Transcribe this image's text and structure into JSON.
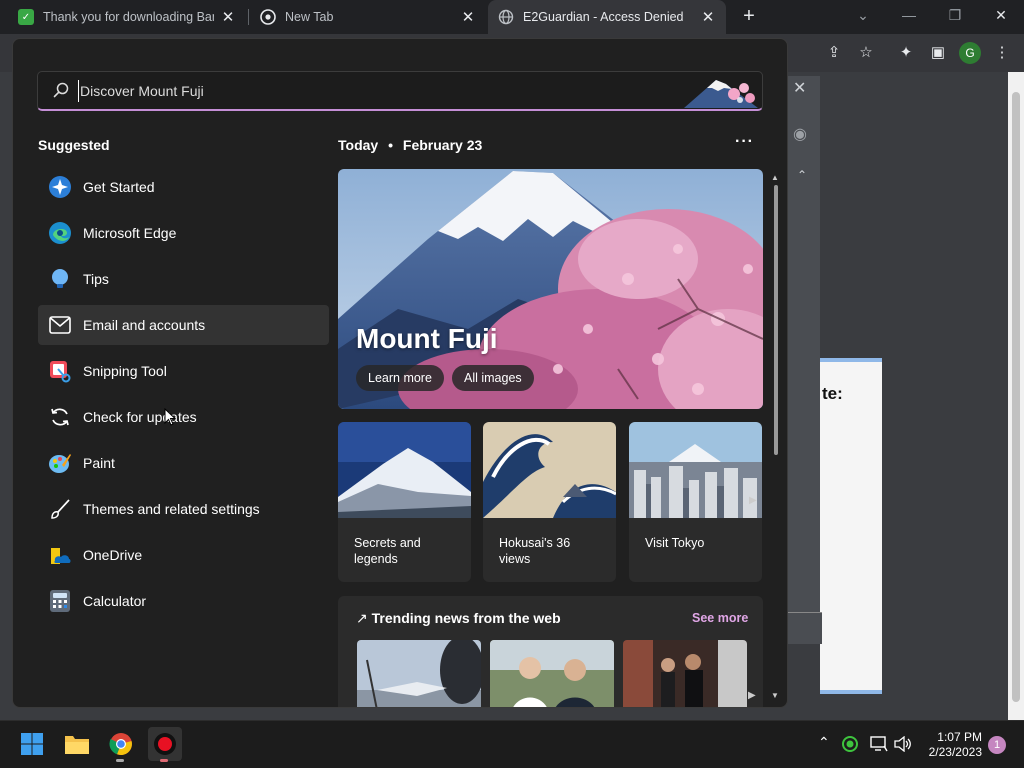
{
  "browser": {
    "tabs": [
      {
        "title": "Thank you for downloading Band",
        "close": "✕"
      },
      {
        "title": "New Tab",
        "close": "✕"
      },
      {
        "title": "E2Guardian - Access Denied",
        "close": "✕"
      }
    ],
    "new_tab": "+",
    "profile_initial": "G"
  },
  "page": {
    "partial_text": "te:"
  },
  "search": {
    "placeholder": "Discover Mount Fuji",
    "value": "Discover Mount Fuji"
  },
  "suggested": {
    "title": "Suggested",
    "apps": [
      {
        "label": "Get Started",
        "icon": "get-started-icon"
      },
      {
        "label": "Microsoft Edge",
        "icon": "edge-icon"
      },
      {
        "label": "Tips",
        "icon": "tips-icon"
      },
      {
        "label": "Email and accounts",
        "icon": "mail-icon"
      },
      {
        "label": "Snipping Tool",
        "icon": "snipping-tool-icon"
      },
      {
        "label": "Check for updates",
        "icon": "refresh-icon"
      },
      {
        "label": "Paint",
        "icon": "paint-icon"
      },
      {
        "label": "Themes and related settings",
        "icon": "brush-icon"
      },
      {
        "label": "OneDrive",
        "icon": "onedrive-icon"
      },
      {
        "label": "Calculator",
        "icon": "calculator-icon"
      }
    ]
  },
  "feed": {
    "today": "Today",
    "date": "February 23",
    "more": "···",
    "hero": {
      "title": "Mount Fuji",
      "learn_more": "Learn more",
      "all_images": "All images"
    },
    "cards": [
      {
        "label": "Secrets and legends"
      },
      {
        "label": "Hokusai's 36 views"
      },
      {
        "label": "Visit Tokyo"
      }
    ],
    "trending": {
      "title": "Trending news from the web",
      "see_more": "See more"
    }
  },
  "taskbar": {
    "clock_time": "1:07 PM",
    "clock_date": "2/23/2023",
    "notification_count": "1"
  }
}
